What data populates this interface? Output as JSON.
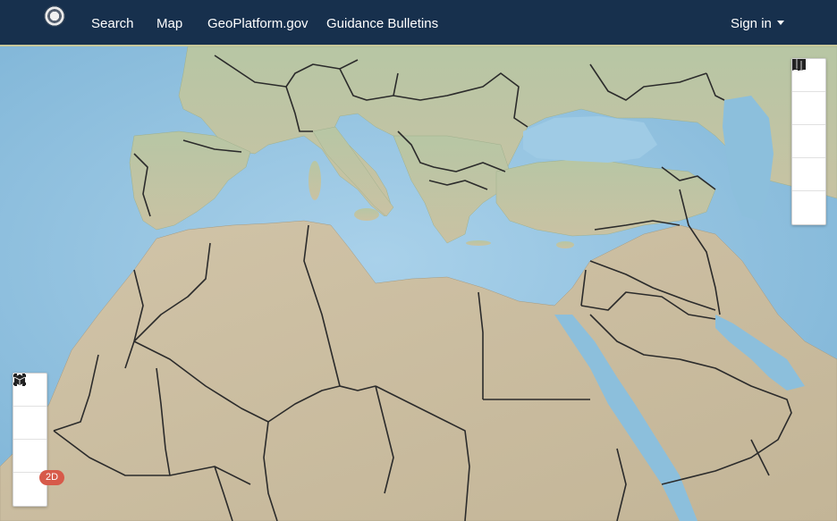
{
  "nav": {
    "links": [
      "Search",
      "Map",
      "GeoPlatform.gov",
      "Guidance Bulletins"
    ],
    "signin": "Sign in"
  },
  "map": {
    "toolbar": [
      "add-icon",
      "layers-icon",
      "table-icon",
      "filter-icon",
      "basemap-icon"
    ],
    "zoom_controls": [
      "zoom-in-icon",
      "zoom-out-icon",
      "fullscreen-icon",
      "view-mode-icon"
    ],
    "view_mode_badge": "2D"
  },
  "colors": {
    "navbar": "#17304d",
    "ocean": "#8fc0de",
    "land": "#cbbd9e",
    "badge": "#d75a4a"
  }
}
